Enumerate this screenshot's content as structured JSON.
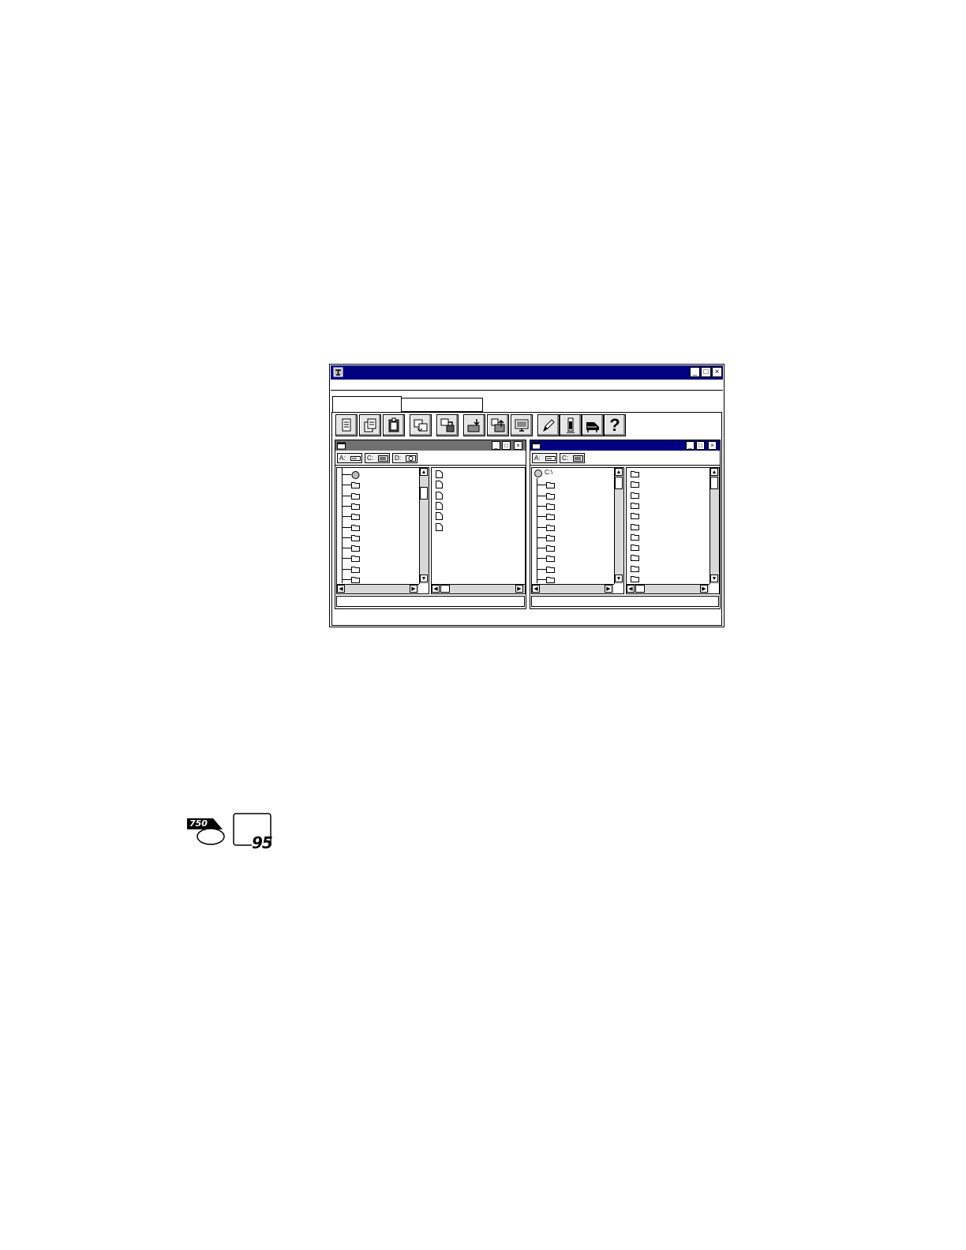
{
  "app": {
    "title": "",
    "menu": [],
    "tabs": [
      {
        "label": ""
      },
      {
        "label": ""
      }
    ]
  },
  "toolbar": {
    "buttons": [
      {
        "icon": "document-icon"
      },
      {
        "icon": "documents-stack-icon"
      },
      {
        "icon": "clipboard-icon"
      },
      {
        "icon": "copy-windows-icon"
      },
      {
        "icon": "transfer-icon"
      },
      {
        "icon": "move-down-icon"
      },
      {
        "icon": "move-up-icon"
      },
      {
        "icon": "monitor-icon"
      },
      {
        "icon": "pen-icon"
      },
      {
        "icon": "tube-icon"
      },
      {
        "icon": "piano-icon"
      },
      {
        "icon": "help-icon"
      }
    ],
    "help_glyph": "?"
  },
  "left_window": {
    "drives": [
      {
        "label": "A:"
      },
      {
        "label": "C:"
      },
      {
        "label": "D:"
      }
    ]
  },
  "right_window": {
    "drives": [
      {
        "label": "A:"
      },
      {
        "label": "C:"
      }
    ],
    "root_label": "C:\\"
  },
  "logos": {
    "left_badge": "750",
    "right_badge": "95"
  }
}
